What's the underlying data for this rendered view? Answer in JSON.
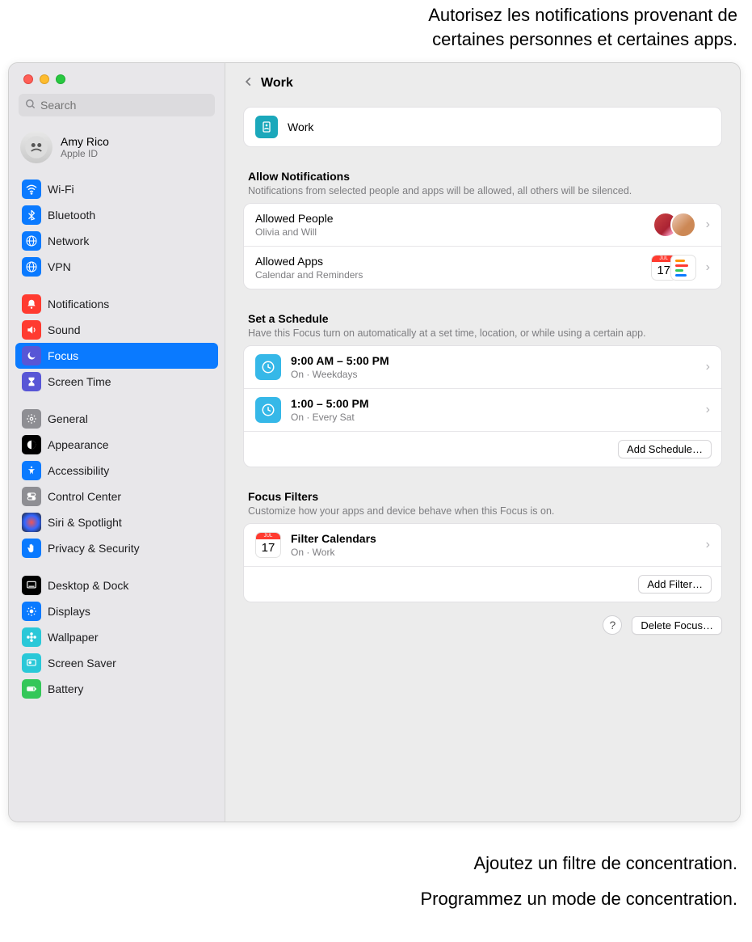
{
  "callouts": {
    "top": "Autorisez les notifications provenant de\ncertaines personnes et certaines apps.",
    "filter": "Ajoutez un filtre de concentration.",
    "schedule": "Programmez un mode de concentration."
  },
  "search": {
    "placeholder": "Search"
  },
  "account": {
    "name": "Amy Rico",
    "sub": "Apple ID"
  },
  "sidebar": {
    "g1": [
      {
        "label": "Wi-Fi",
        "bg": "#0a7aff"
      },
      {
        "label": "Bluetooth",
        "bg": "#0a7aff"
      },
      {
        "label": "Network",
        "bg": "#0a7aff"
      },
      {
        "label": "VPN",
        "bg": "#0a7aff"
      }
    ],
    "g2": [
      {
        "label": "Notifications",
        "bg": "#ff3b30"
      },
      {
        "label": "Sound",
        "bg": "#ff3b30"
      },
      {
        "label": "Focus",
        "bg": "#5856d6"
      },
      {
        "label": "Screen Time",
        "bg": "#5856d6"
      }
    ],
    "g3": [
      {
        "label": "General",
        "bg": "#8e8e93"
      },
      {
        "label": "Appearance",
        "bg": "#000"
      },
      {
        "label": "Accessibility",
        "bg": "#0a7aff"
      },
      {
        "label": "Control Center",
        "bg": "#8e8e93"
      },
      {
        "label": "Siri & Spotlight",
        "bg": "#222"
      },
      {
        "label": "Privacy & Security",
        "bg": "#0a7aff"
      }
    ],
    "g4": [
      {
        "label": "Desktop & Dock",
        "bg": "#000"
      },
      {
        "label": "Displays",
        "bg": "#0a7aff"
      },
      {
        "label": "Wallpaper",
        "bg": "#2ac8d8"
      },
      {
        "label": "Screen Saver",
        "bg": "#2ac8d8"
      },
      {
        "label": "Battery",
        "bg": "#34c759"
      }
    ]
  },
  "page": {
    "title": "Work",
    "focusName": "Work"
  },
  "notifications": {
    "title": "Allow Notifications",
    "desc": "Notifications from selected people and apps will be allowed, all others will be silenced.",
    "people": {
      "title": "Allowed People",
      "sub": "Olivia and Will"
    },
    "apps": {
      "title": "Allowed Apps",
      "sub": "Calendar and Reminders",
      "calDay": "17",
      "calMon": "JUL"
    }
  },
  "schedule": {
    "title": "Set a Schedule",
    "desc": "Have this Focus turn on automatically at a set time, location, or while using a certain app.",
    "items": [
      {
        "time": "9:00 AM – 5:00 PM",
        "sub": "On · Weekdays"
      },
      {
        "time": "1:00 – 5:00 PM",
        "sub": "On · Every Sat"
      }
    ],
    "add": "Add Schedule…"
  },
  "filters": {
    "title": "Focus Filters",
    "desc": "Customize how your apps and device behave when this Focus is on.",
    "item": {
      "title": "Filter Calendars",
      "sub": "On · Work",
      "calDay": "17",
      "calMon": "JUL"
    },
    "add": "Add Filter…"
  },
  "actions": {
    "help": "?",
    "delete": "Delete Focus…"
  }
}
